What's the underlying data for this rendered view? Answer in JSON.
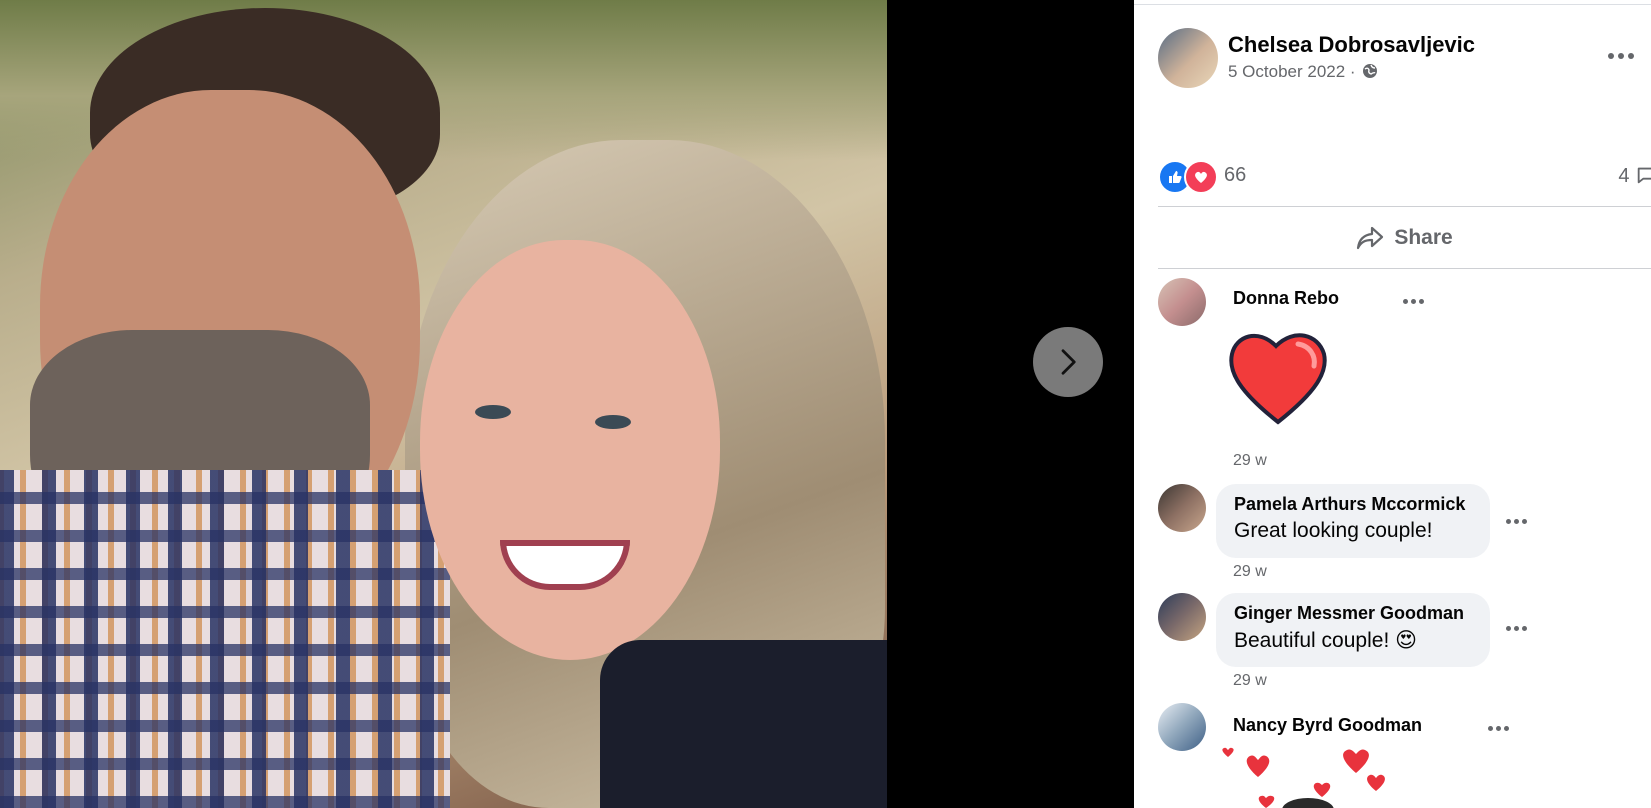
{
  "post": {
    "author": "Chelsea Dobrosavljevic",
    "date": "5 October 2022",
    "separator": " · ",
    "privacy_icon": "globe-icon",
    "reaction_count": "66",
    "comment_count": "4",
    "share_label": "Share"
  },
  "comments": [
    {
      "name": "Donna Rebo",
      "text": "",
      "sticker": "red-heart",
      "time": "29 w"
    },
    {
      "name": "Pamela Arthurs Mccormick",
      "text": "Great looking couple!",
      "time": "29 w"
    },
    {
      "name": "Ginger Messmer Goodman",
      "text": "Beautiful couple! 😍",
      "time": "29 w"
    },
    {
      "name": "Nancy Byrd Goodman",
      "text": "",
      "sticker": "hearts-animation",
      "time": ""
    }
  ],
  "colors": {
    "like_blue": "#1877f2",
    "love_red": "#f33e58",
    "secondary_text": "#65676b",
    "bubble_bg": "#f0f2f5"
  }
}
